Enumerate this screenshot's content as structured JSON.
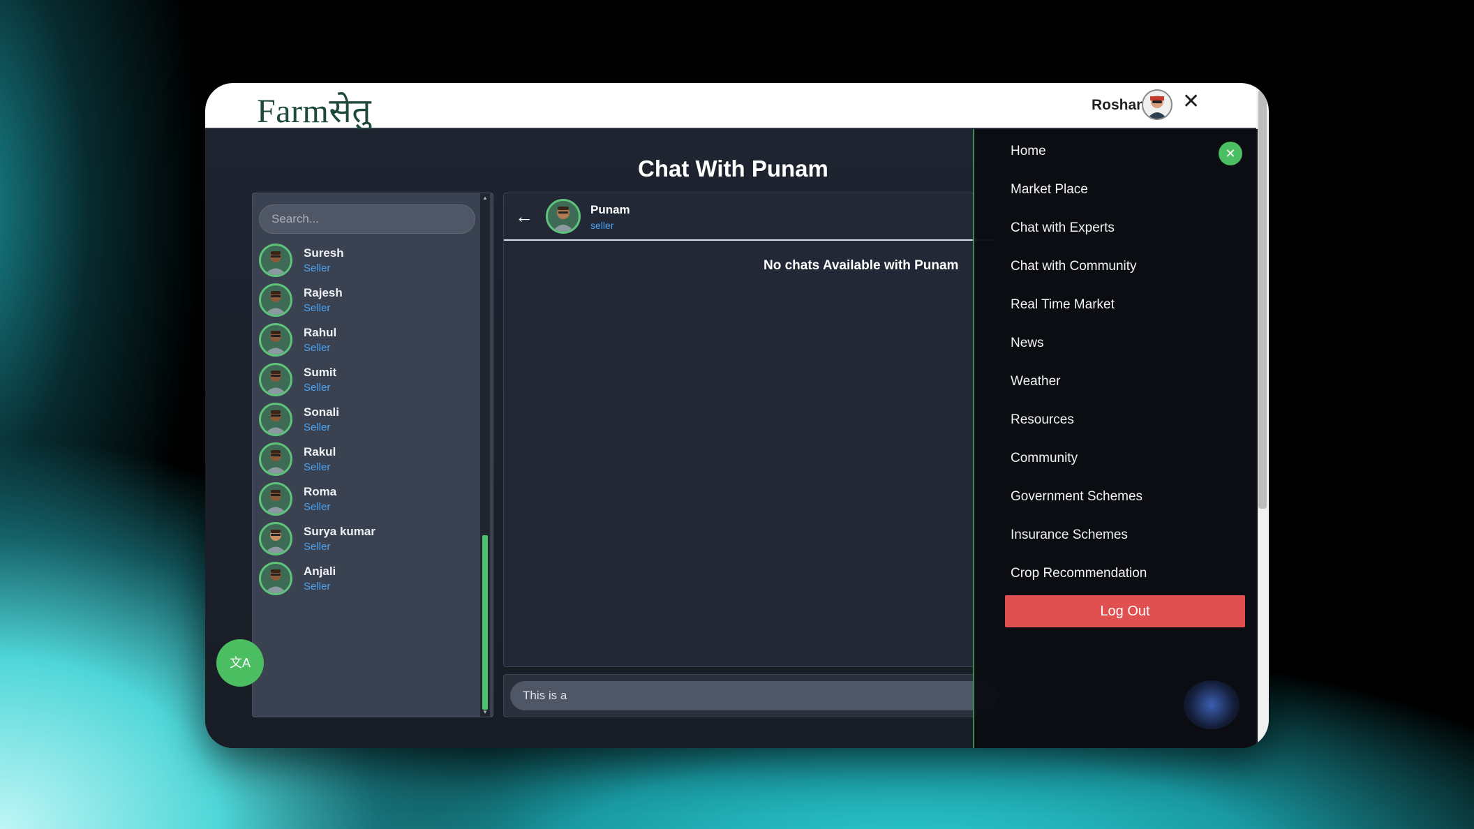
{
  "header": {
    "logo": "Farmसेतु",
    "user_name": "Roshan",
    "close_glyph": "✕"
  },
  "page": {
    "title": "Chat With Punam"
  },
  "contacts": {
    "search_placeholder": "Search...",
    "items": [
      {
        "name": "Suresh",
        "role": "Seller"
      },
      {
        "name": "Rajesh",
        "role": "Seller"
      },
      {
        "name": "Rahul",
        "role": "Seller"
      },
      {
        "name": "Sumit",
        "role": "Seller"
      },
      {
        "name": "Sonali",
        "role": "Seller"
      },
      {
        "name": "Rakul",
        "role": "Seller"
      },
      {
        "name": "Roma",
        "role": "Seller"
      },
      {
        "name": "Surya kumar",
        "role": "Seller"
      },
      {
        "name": "Anjali",
        "role": "Seller"
      }
    ]
  },
  "chat": {
    "name": "Punam",
    "role": "seller",
    "empty_message": "No chats Available with Punam",
    "input_value": "This is a"
  },
  "menu": {
    "items": [
      "Home",
      "Market Place",
      "Chat with Experts",
      "Chat with Community",
      "Real Time Market",
      "News",
      "Weather",
      "Resources",
      "Community",
      "Government Schemes",
      "Insurance Schemes",
      "Crop Recommendation"
    ],
    "logout_label": "Log Out",
    "close_glyph": "✕"
  },
  "translate": {
    "glyph": "文A"
  },
  "colors": {
    "accent": "#4cbe62",
    "logout": "#e05050",
    "role_link": "#4ba3f2"
  }
}
